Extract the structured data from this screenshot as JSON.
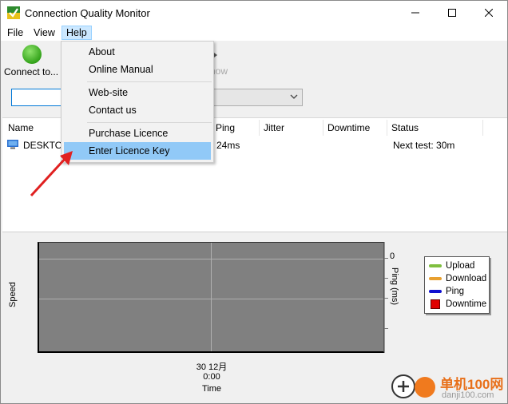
{
  "window": {
    "title": "Connection Quality Monitor"
  },
  "menubar": {
    "file": "File",
    "view": "View",
    "help": "Help"
  },
  "toolbar": {
    "connect_label": "Connect to...",
    "now_label": "now"
  },
  "help_menu": {
    "items": [
      "About",
      "Online Manual",
      "Web-site",
      "Contact us",
      "Purchase Licence",
      "Enter Licence Key"
    ],
    "highlighted": "Enter Licence Key"
  },
  "list": {
    "columns": [
      "Name",
      "Ping",
      "Jitter",
      "Downtime",
      "Status"
    ],
    "rows": [
      {
        "name": "DESKTOP",
        "ping": "24ms",
        "jitter": "",
        "downtime": "",
        "status": "Next test: 30m"
      }
    ]
  },
  "chart": {
    "y_left_label": "Speed",
    "y_right_label": "Ping (ms)",
    "y_right_tick": "0",
    "x_ticks": [
      "30 12月",
      "0:00"
    ],
    "x_label": "Time",
    "legend": [
      {
        "name": "Upload",
        "color": "#7fbf3f"
      },
      {
        "name": "Download",
        "color": "#e8a030"
      },
      {
        "name": "Ping",
        "color": "#1010d0"
      },
      {
        "name": "Downtime",
        "color": "#e00000"
      }
    ]
  },
  "chart_data": {
    "type": "line",
    "x": [],
    "series": [
      {
        "name": "Upload",
        "values": []
      },
      {
        "name": "Download",
        "values": []
      },
      {
        "name": "Ping",
        "values": []
      },
      {
        "name": "Downtime",
        "values": []
      }
    ],
    "xlabel": "Time",
    "ylabel": "Speed",
    "y2label": "Ping (ms)",
    "grid": true,
    "legend": "right"
  },
  "watermark": {
    "line1": "单机100网",
    "line2": "danji100.com"
  }
}
